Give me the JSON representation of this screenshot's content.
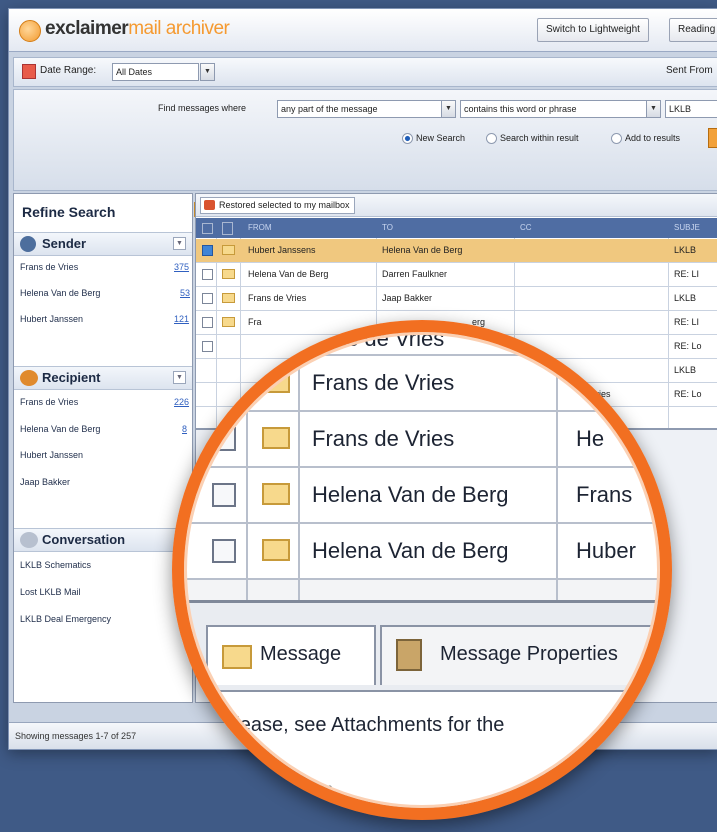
{
  "app": {
    "logo_bold": "exclaimer",
    "logo_light": "mail archiver",
    "switch_button": "Switch to Lightweight",
    "reading_button": "Reading"
  },
  "date_range": {
    "label": "Date Range:",
    "value": "All Dates",
    "sent_from_label": "Sent From"
  },
  "find": {
    "label": "Find messages where",
    "field_value": "any part of the message",
    "condition_value": "contains this word or phrase",
    "query_value": "LKLB",
    "options": [
      {
        "label": "New Search",
        "selected": true
      },
      {
        "label": "Search within result",
        "selected": false
      },
      {
        "label": "Add to results",
        "selected": false
      }
    ]
  },
  "refine": {
    "title": "Refine Search",
    "sender": {
      "title": "Sender",
      "items": [
        {
          "name": "Frans de Vries",
          "count": "375"
        },
        {
          "name": "Helena Van de Berg",
          "count": "53"
        },
        {
          "name": "Hubert Janssen",
          "count": "121"
        }
      ]
    },
    "recipient": {
      "title": "Recipient",
      "items": [
        {
          "name": "Frans de Vries",
          "count": "226"
        },
        {
          "name": "Helena Van de Berg",
          "count": "8"
        },
        {
          "name": "Hubert Janssen",
          "count": ""
        },
        {
          "name": "Jaap Bakker",
          "count": ""
        }
      ]
    },
    "conversation": {
      "title": "Conversation",
      "items": [
        "LKLB Schematics",
        "Lost LKLB Mail",
        "LKLB Deal Emergency"
      ]
    }
  },
  "grid": {
    "restore_label": "Restored selected to my mailbox",
    "headers": {
      "from": "FROM",
      "to": "TO",
      "cc": "CC",
      "subject": "SUBJE"
    },
    "rows": [
      {
        "from": "Hubert Janssens",
        "to": "Helena Van de Berg",
        "subject": "LKLB",
        "selected": true
      },
      {
        "from": "Helena Van de Berg",
        "to": "Darren Faulkner",
        "subject": "RE: LI",
        "selected": false
      },
      {
        "from": "Frans de Vries",
        "to": "Jaap Bakker",
        "subject": "LKLB",
        "selected": false
      },
      {
        "from": "Fra",
        "to": "erg",
        "subject": "RE: LI",
        "selected": false
      },
      {
        "from": "",
        "to": "",
        "subject": "RE: Lo",
        "selected": false
      },
      {
        "from": "",
        "to": "",
        "subject": "LKLB",
        "selected": false
      },
      {
        "from": "",
        "to": "ries",
        "subject": "RE: Lo",
        "selected": false
      }
    ]
  },
  "status": {
    "text": "Showing messages 1-7 of 257"
  },
  "lens": {
    "top_partial": "Frans de Vries",
    "rows": [
      {
        "from": "Frans de Vries",
        "to": ""
      },
      {
        "from": "Frans de Vries",
        "to": "He"
      },
      {
        "from": "Helena Van de Berg",
        "to": "Frans"
      },
      {
        "from": "Helena Van de Berg",
        "to": "Huber"
      }
    ],
    "tab_message": "Message",
    "tab_properties": "Message Properties",
    "body_text": "Please, see Attachments for the",
    "body_sub": "Janssen"
  }
}
